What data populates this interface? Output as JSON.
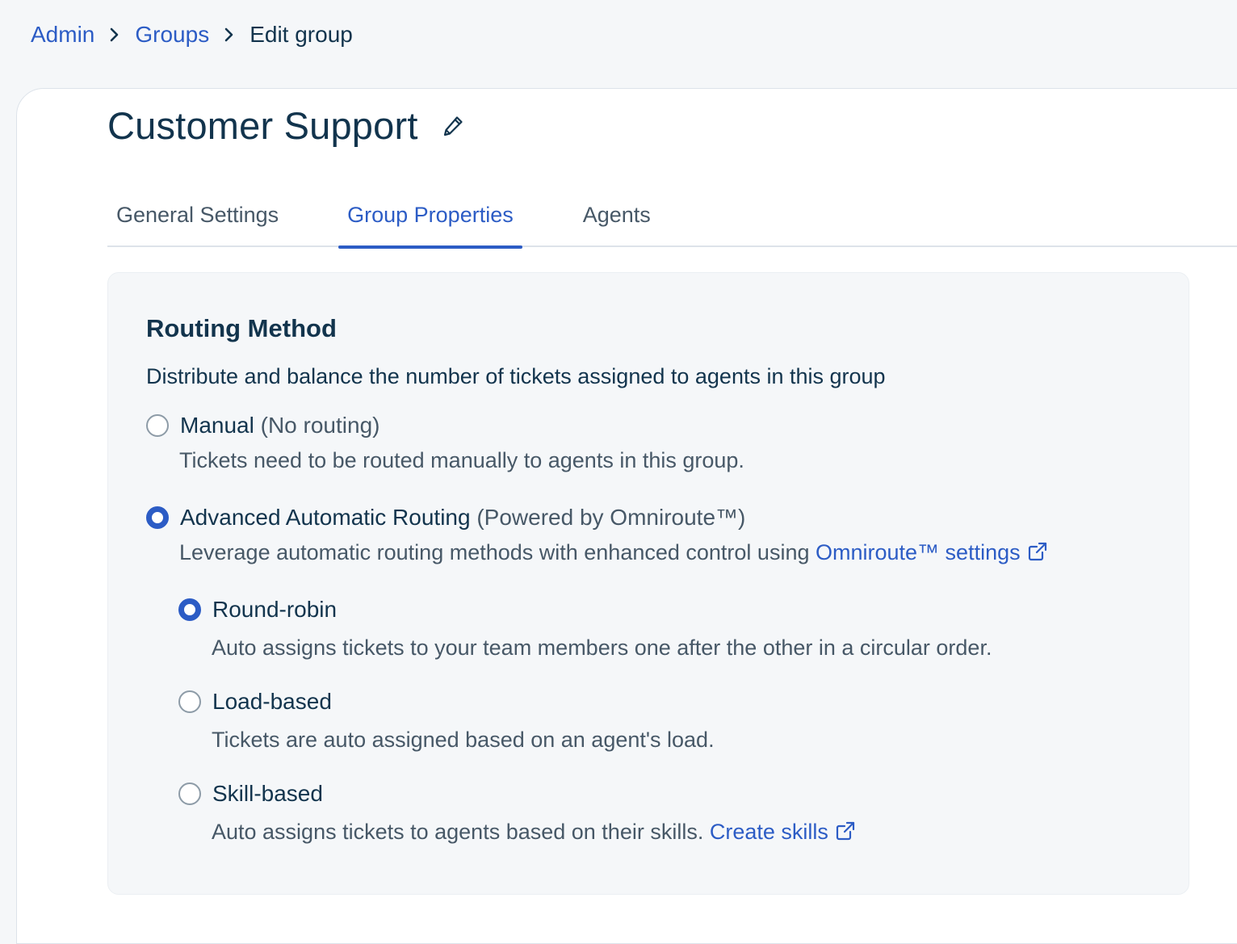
{
  "breadcrumb": {
    "items": [
      "Admin",
      "Groups"
    ],
    "current": "Edit group"
  },
  "page": {
    "title": "Customer Support"
  },
  "tabs": [
    {
      "label": "General Settings",
      "active": false
    },
    {
      "label": "Group Properties",
      "active": true
    },
    {
      "label": "Agents",
      "active": false
    }
  ],
  "routing": {
    "title": "Routing Method",
    "description": "Distribute and balance the number of tickets assigned to agents in this group",
    "manual": {
      "label": "Manual",
      "suffix": "(No routing)",
      "description": "Tickets need to be routed manually to agents in this group.",
      "selected": false
    },
    "advanced": {
      "label": "Advanced Automatic Routing",
      "suffix": "(Powered by Omniroute™)",
      "description": "Leverage automatic routing methods with enhanced control using",
      "link": "Omniroute™ settings",
      "selected": true
    },
    "round_robin": {
      "label": "Round-robin",
      "description": "Auto assigns tickets to your team members one after the other in a circular order.",
      "selected": true
    },
    "load_based": {
      "label": "Load-based",
      "description": "Tickets are auto assigned based on an agent's load.",
      "selected": false
    },
    "skill_based": {
      "label": "Skill-based",
      "description": "Auto assigns tickets to agents based on their skills.",
      "link": "Create skills",
      "selected": false
    }
  },
  "colors": {
    "accent": "#2c5cc5",
    "text_primary": "#12344d",
    "text_secondary": "#475867",
    "background": "#f5f7f9"
  }
}
